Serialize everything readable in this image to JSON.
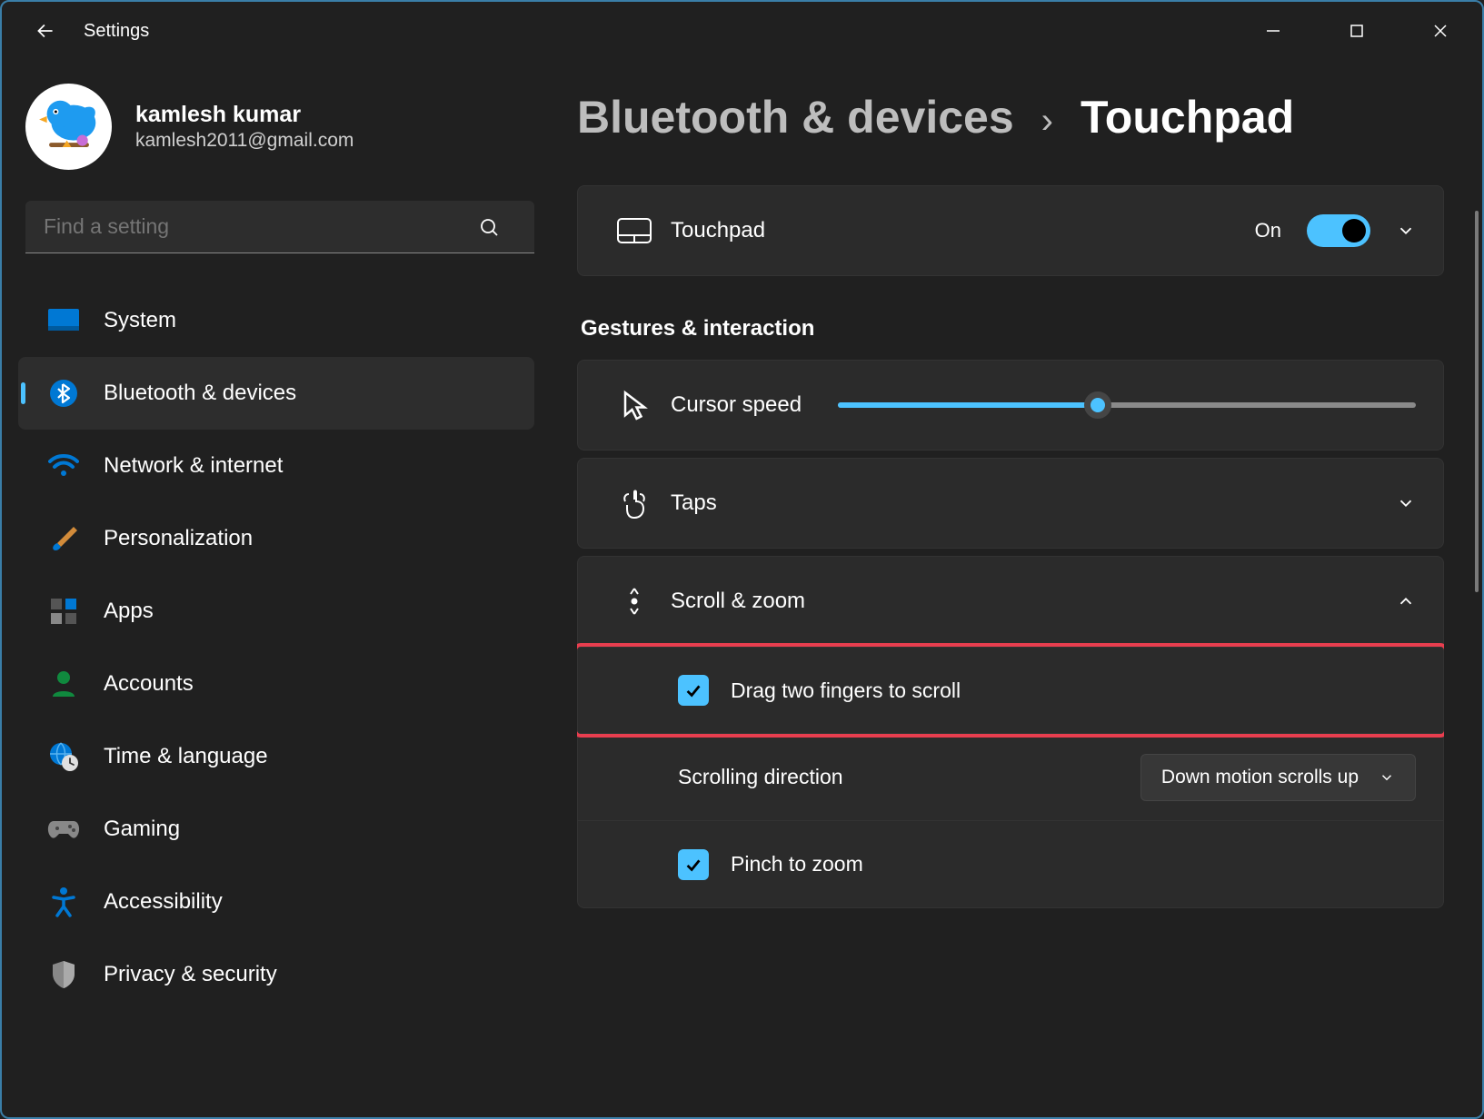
{
  "window": {
    "title": "Settings"
  },
  "user": {
    "name": "kamlesh kumar",
    "email": "kamlesh2011@gmail.com"
  },
  "search": {
    "placeholder": "Find a setting"
  },
  "sidebar": {
    "items": [
      {
        "label": "System"
      },
      {
        "label": "Bluetooth & devices"
      },
      {
        "label": "Network & internet"
      },
      {
        "label": "Personalization"
      },
      {
        "label": "Apps"
      },
      {
        "label": "Accounts"
      },
      {
        "label": "Time & language"
      },
      {
        "label": "Gaming"
      },
      {
        "label": "Accessibility"
      },
      {
        "label": "Privacy & security"
      }
    ],
    "active_index": 1
  },
  "breadcrumb": {
    "parent": "Bluetooth & devices",
    "current": "Touchpad"
  },
  "touchpad_card": {
    "label": "Touchpad",
    "state": "On"
  },
  "gestures_heading": "Gestures & interaction",
  "cursor_speed": {
    "label": "Cursor speed",
    "percent": 45
  },
  "taps": {
    "label": "Taps"
  },
  "scroll_zoom": {
    "label": "Scroll & zoom",
    "drag_two_fingers": "Drag two fingers to scroll",
    "scrolling_direction_label": "Scrolling direction",
    "scrolling_direction_value": "Down motion scrolls up",
    "pinch_to_zoom": "Pinch to zoom"
  }
}
